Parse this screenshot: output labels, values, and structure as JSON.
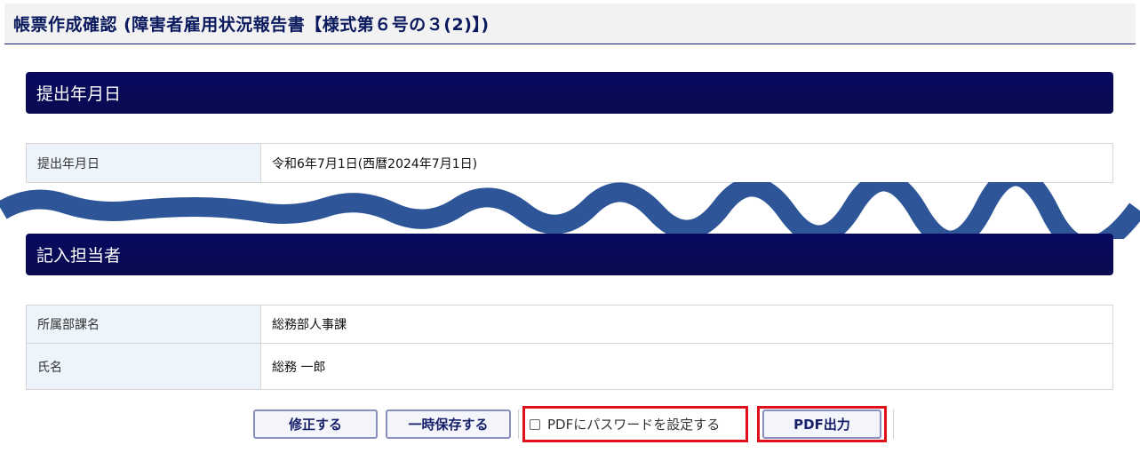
{
  "page": {
    "title": "帳票作成確認 (障害者雇用状況報告書【様式第６号の３(2)】)"
  },
  "sections": {
    "submission": {
      "heading": "提出年月日",
      "rows": [
        {
          "label": "提出年月日",
          "value": "令和6年7月1日(西暦2024年7月1日)"
        }
      ]
    },
    "contact": {
      "heading": "記入担当者",
      "rows": [
        {
          "label": "所属部課名",
          "value": "総務部人事課"
        },
        {
          "label": "氏名",
          "value": "総務 一郎"
        }
      ]
    }
  },
  "actions": {
    "modify_label": "修正する",
    "save_temp_label": "一時保存する",
    "pdf_password_label": "PDFにパスワードを設定する",
    "pdf_output_label": "PDF出力"
  },
  "colors": {
    "section_band": "#06095f",
    "label_cell_bg": "#edf4fb",
    "wave": "#2e5597",
    "highlight": "#e0101a"
  }
}
